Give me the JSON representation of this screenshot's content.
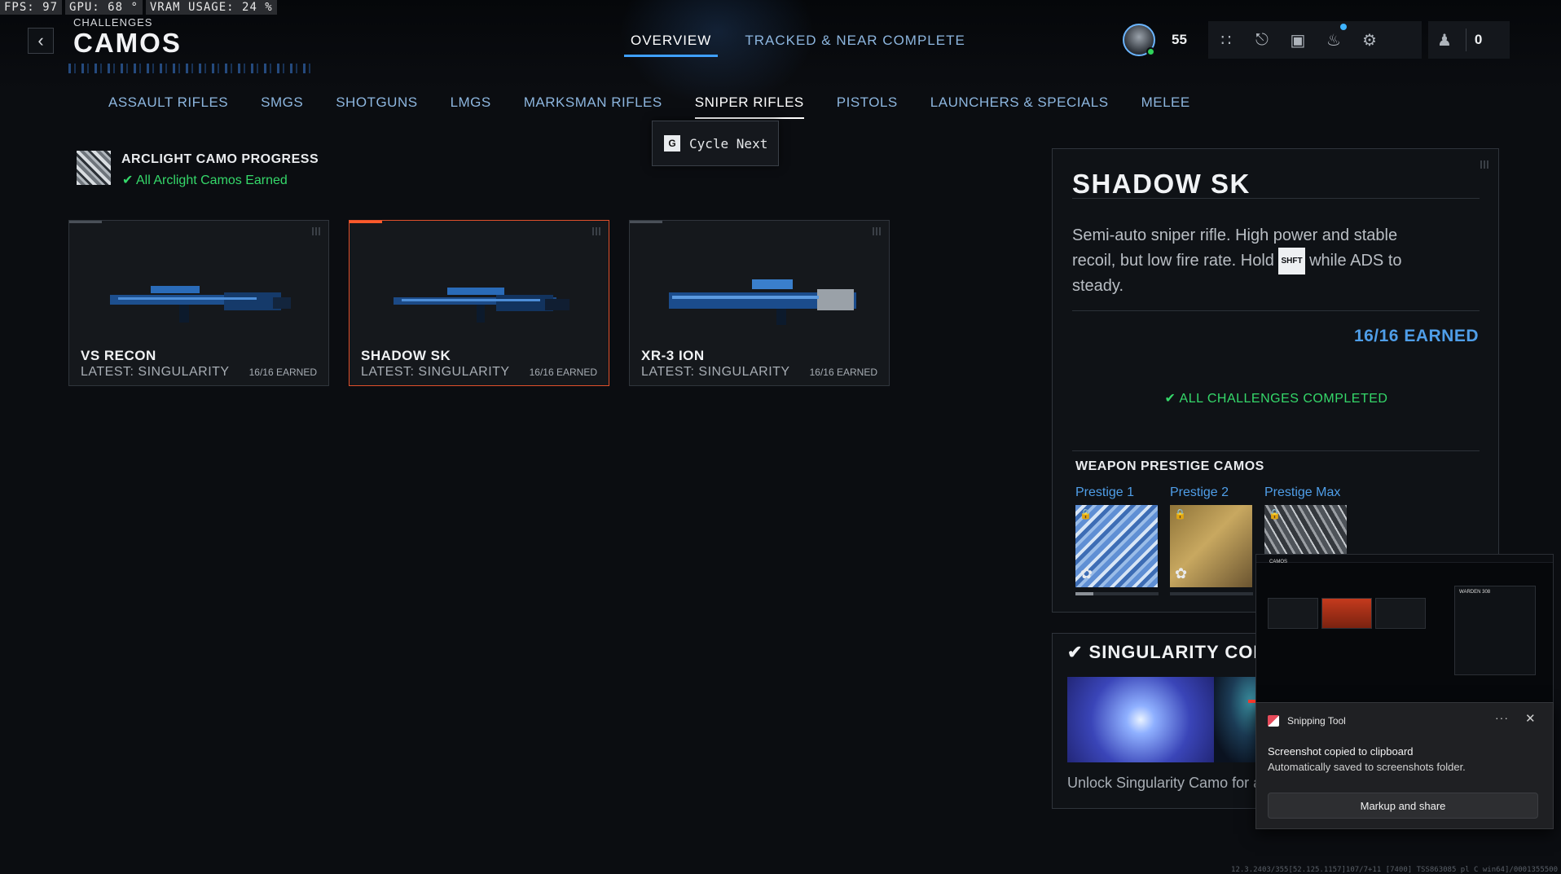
{
  "perf": {
    "fps": "FPS:  97",
    "gpu": "GPU: 68 °",
    "vram": "VRAM USAGE: 24 %"
  },
  "header": {
    "breadcrumb": "CHALLENGES",
    "title": "CAMOS",
    "back_icon": "chevron-left-icon",
    "top_tabs": [
      {
        "label": "OVERVIEW",
        "active": true
      },
      {
        "label": "TRACKED & NEAR COMPLETE",
        "active": false
      }
    ],
    "player_level": "55",
    "count": "0",
    "hud_icons": [
      "apps-grid-icon",
      "unlock-icon",
      "camera-icon",
      "bell-icon",
      "gear-icon",
      "friends-icon"
    ]
  },
  "categories": [
    {
      "label": "ASSAULT RIFLES",
      "active": false
    },
    {
      "label": "SMGS",
      "active": false
    },
    {
      "label": "SHOTGUNS",
      "active": false
    },
    {
      "label": "LMGS",
      "active": false
    },
    {
      "label": "MARKSMAN RIFLES",
      "active": false
    },
    {
      "label": "SNIPER RIFLES",
      "active": true
    },
    {
      "label": "PISTOLS",
      "active": false
    },
    {
      "label": "LAUNCHERS & SPECIALS",
      "active": false
    },
    {
      "label": "MELEE",
      "active": false
    }
  ],
  "cycle_tip": {
    "key": "G",
    "label": "Cycle Next"
  },
  "arclight": {
    "title": "ARCLIGHT CAMO PROGRESS",
    "status": "All Arclight Camos Earned"
  },
  "weapons": [
    {
      "name": "VS RECON",
      "latest": "LATEST: SINGULARITY",
      "earned": "16/16 EARNED",
      "selected": false
    },
    {
      "name": "SHADOW SK",
      "latest": "LATEST: SINGULARITY",
      "earned": "16/16 EARNED",
      "selected": true
    },
    {
      "name": "XR-3 ION",
      "latest": "LATEST: SINGULARITY",
      "earned": "16/16 EARNED",
      "selected": false
    }
  ],
  "detail": {
    "title": "SHADOW SK",
    "desc_before": "Semi-auto sniper rifle. High power and stable recoil, but low fire rate. Hold ",
    "desc_key": "SHFT",
    "desc_after": " while ADS to steady.",
    "earned": "16/16 EARNED",
    "complete": "ALL CHALLENGES COMPLETED",
    "prestige_heading": "WEAPON PRESTIGE CAMOS",
    "prestige": [
      {
        "label": "Prestige 1"
      },
      {
        "label": "Prestige 2"
      },
      {
        "label": "Prestige Max"
      }
    ]
  },
  "singularity": {
    "heading": "SINGULARITY COLLE",
    "desc": "Unlock Singularity Camo for any V"
  },
  "snipping": {
    "preview_title": "CAMOS",
    "preview_panel_title": "WARDEN 308",
    "app": "Snipping Tool",
    "more": "···",
    "close": "✕",
    "line1": "Screenshot copied to clipboard",
    "line2": "Automatically saved to screenshots folder.",
    "button": "Markup and share"
  },
  "build": "12.3.2403/355[52.125.1157]107/7+11 [7400] TSS863085 pl C win64]/0001355500"
}
